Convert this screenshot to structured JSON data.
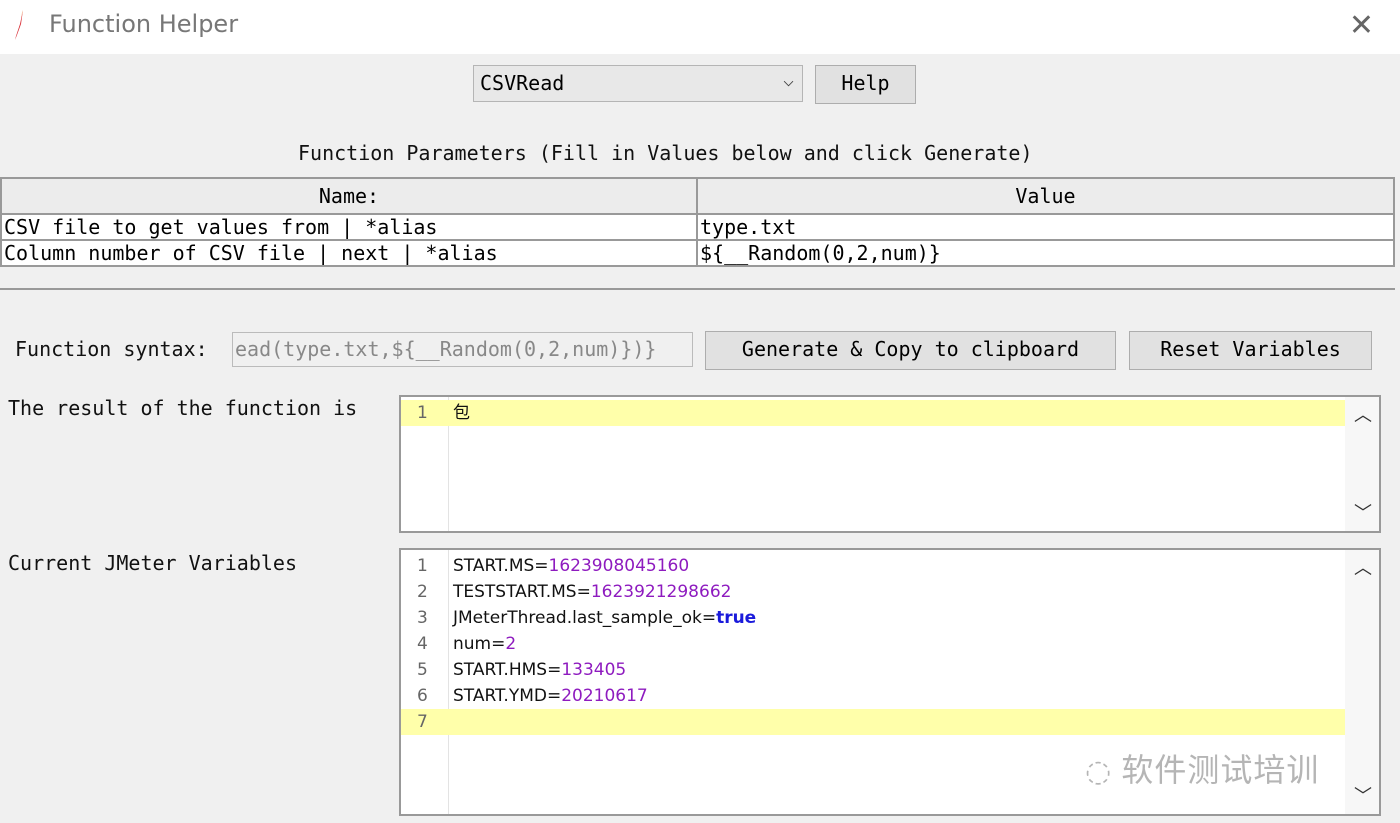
{
  "window": {
    "title": "Function Helper",
    "close_icon": "close-icon",
    "app_icon": "feather-icon"
  },
  "function_select": {
    "value": "CSVRead",
    "help_label": "Help"
  },
  "params": {
    "heading": "Function Parameters (Fill in Values below and click Generate)",
    "columns": [
      "Name:",
      "Value"
    ],
    "rows": [
      {
        "name": "CSV file to get values from | *alias",
        "value": "type.txt"
      },
      {
        "name": "Column number of CSV file | next | *alias",
        "value": "${__Random(0,2,num)}"
      }
    ]
  },
  "syntax": {
    "label": "Function syntax:",
    "value": "ead(type.txt,${__Random(0,2,num)})}",
    "generate_label": "Generate & Copy to clipboard",
    "reset_label": "Reset Variables"
  },
  "result": {
    "label": "The result of the function is",
    "lines": [
      "包"
    ]
  },
  "variables": {
    "label": "Current JMeter Variables",
    "lines": [
      {
        "n": "1",
        "key": "START.MS=",
        "val": "1623908045160",
        "type": "num"
      },
      {
        "n": "2",
        "key": "TESTSTART.MS=",
        "val": "1623921298662",
        "type": "num"
      },
      {
        "n": "3",
        "key": "JMeterThread.last_sample_ok=",
        "val": "true",
        "type": "kw"
      },
      {
        "n": "4",
        "key": "num=",
        "val": "2",
        "type": "num"
      },
      {
        "n": "5",
        "key": "START.HMS=",
        "val": "133405",
        "type": "num"
      },
      {
        "n": "6",
        "key": "START.YMD=",
        "val": "20210617",
        "type": "num"
      },
      {
        "n": "7",
        "key": "",
        "val": "",
        "type": "num"
      }
    ]
  },
  "watermark": "软件测试培训",
  "colors": {
    "highlight": "#ffffaa",
    "number": "#8e1bbf",
    "keyword": "#1a1adb"
  }
}
